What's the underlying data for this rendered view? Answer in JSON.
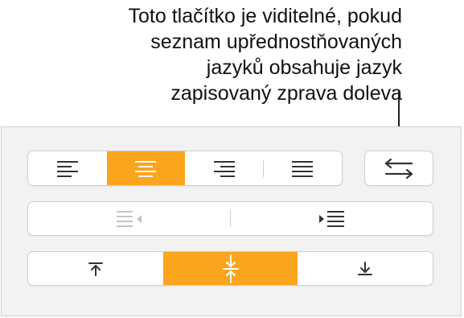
{
  "callout": {
    "lines": [
      "Toto tlačítko je viditelné, pokud",
      "seznam upřednostňovaných",
      "jazyků obsahuje jazyk",
      "zapisovaný zprava doleva"
    ]
  },
  "alignment": {
    "selected": "center",
    "options": [
      "align-left",
      "align-center",
      "align-right",
      "justify"
    ]
  },
  "direction_toggle": {
    "icon": "text-direction-icon"
  },
  "indent": {
    "decrease_enabled": false,
    "increase_enabled": true
  },
  "vertical_alignment": {
    "selected": "middle",
    "options": [
      "align-top",
      "align-middle",
      "align-bottom"
    ]
  },
  "colors": {
    "accent": "#fba41d",
    "panel_bg": "#f2f2f2",
    "border": "#cfcfcf"
  }
}
